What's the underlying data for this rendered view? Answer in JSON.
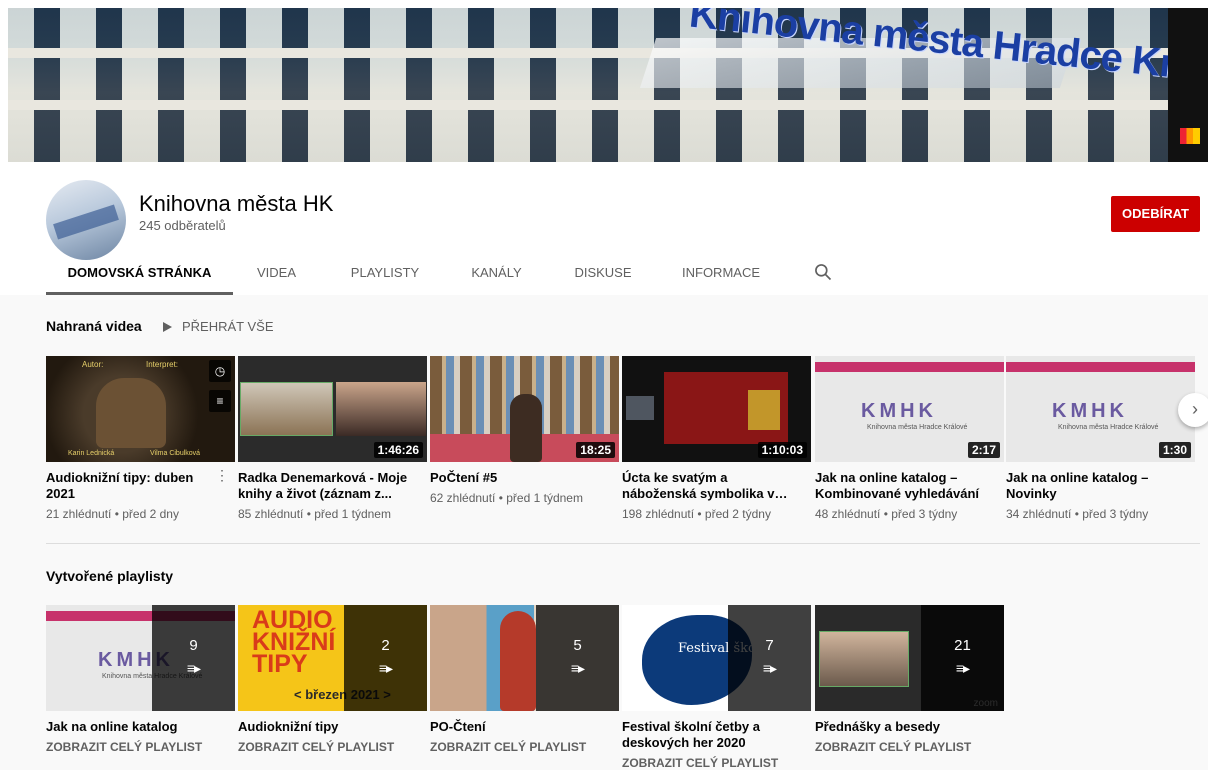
{
  "banner": {
    "title": "Knihovna města Hradce Králové"
  },
  "channel": {
    "name": "Knihovna města HK",
    "subscribers": "245 odběratelů",
    "subscribe_label": "ODEBÍRAT"
  },
  "tabs": [
    {
      "label": "DOMOVSKÁ STRÁNKA",
      "active": true
    },
    {
      "label": "VIDEA"
    },
    {
      "label": "PLAYLISTY"
    },
    {
      "label": "KANÁLY"
    },
    {
      "label": "DISKUSE"
    },
    {
      "label": "INFORMACE"
    }
  ],
  "uploads": {
    "title": "Nahraná videa",
    "play_all": "PŘEHRÁT VŠE",
    "videos": [
      {
        "title": "Audioknižní tipy: duben 2021",
        "meta": "21 zhlédnutí • před 2 dny",
        "duration": "",
        "thumb_text_1": "Autor:",
        "thumb_text_2": "Interpret:",
        "thumb_text_3": "Karin Lednická",
        "thumb_text_4": "Vilma Cibulková"
      },
      {
        "title": "Radka Denemarková - Moje knihy a život (záznam z...",
        "meta": "85 zhlédnutí • před 1 týdnem",
        "duration": "1:46:26"
      },
      {
        "title": "PoČtení #5",
        "meta": "62 zhlédnutí • před 1 týdnem",
        "duration": "18:25"
      },
      {
        "title": "Úcta ke svatým a náboženská symbolika v Hradci Králové...",
        "meta": "198 zhlédnutí • před 2 týdny",
        "duration": "1:10:03"
      },
      {
        "title": "Jak na online katalog – Kombinované vyhledávání",
        "meta": "48 zhlédnutí • před 3 týdny",
        "duration": "2:17",
        "logo": "KMHK",
        "logo_sub": "Knihovna města Hradce Králové"
      },
      {
        "title": "Jak na online katalog – Novinky",
        "meta": "34 zhlédnutí • před 3 týdny",
        "duration": "1:30",
        "logo": "KMHK",
        "logo_sub": "Knihovna města Hradce Králové"
      }
    ]
  },
  "playlists": {
    "title": "Vytvořené playlisty",
    "link_label": "ZOBRAZIT CELÝ PLAYLIST",
    "items": [
      {
        "title": "Jak na online katalog",
        "count": "9",
        "logo": "KMHK",
        "logo_sub": "Knihovna města Hradce Králové"
      },
      {
        "title": "Audioknižní tipy",
        "count": "2",
        "thumb_text": "AUDIO KNIŽNÍ TIPY",
        "thumb_sub": "< březen 2021 >"
      },
      {
        "title": "PO-Čtení",
        "count": "5"
      },
      {
        "title": "Festival školní četby a deskových her 2020",
        "count": "7",
        "thumb_text": "Festival školní četby"
      },
      {
        "title": "Přednášky a besedy",
        "count": "21",
        "thumb_sub": "zoom"
      }
    ]
  },
  "icons": {
    "search": "search-icon",
    "next": "chevron-right-icon",
    "play": "play-icon",
    "playlist": "playlist-icon",
    "clock": "clock-icon",
    "queue": "add-to-queue-icon",
    "more": "more-vert-icon"
  },
  "colors": {
    "subscribe": "#cc0000",
    "meta": "#606060",
    "page_bg": "#f9f9f9"
  }
}
